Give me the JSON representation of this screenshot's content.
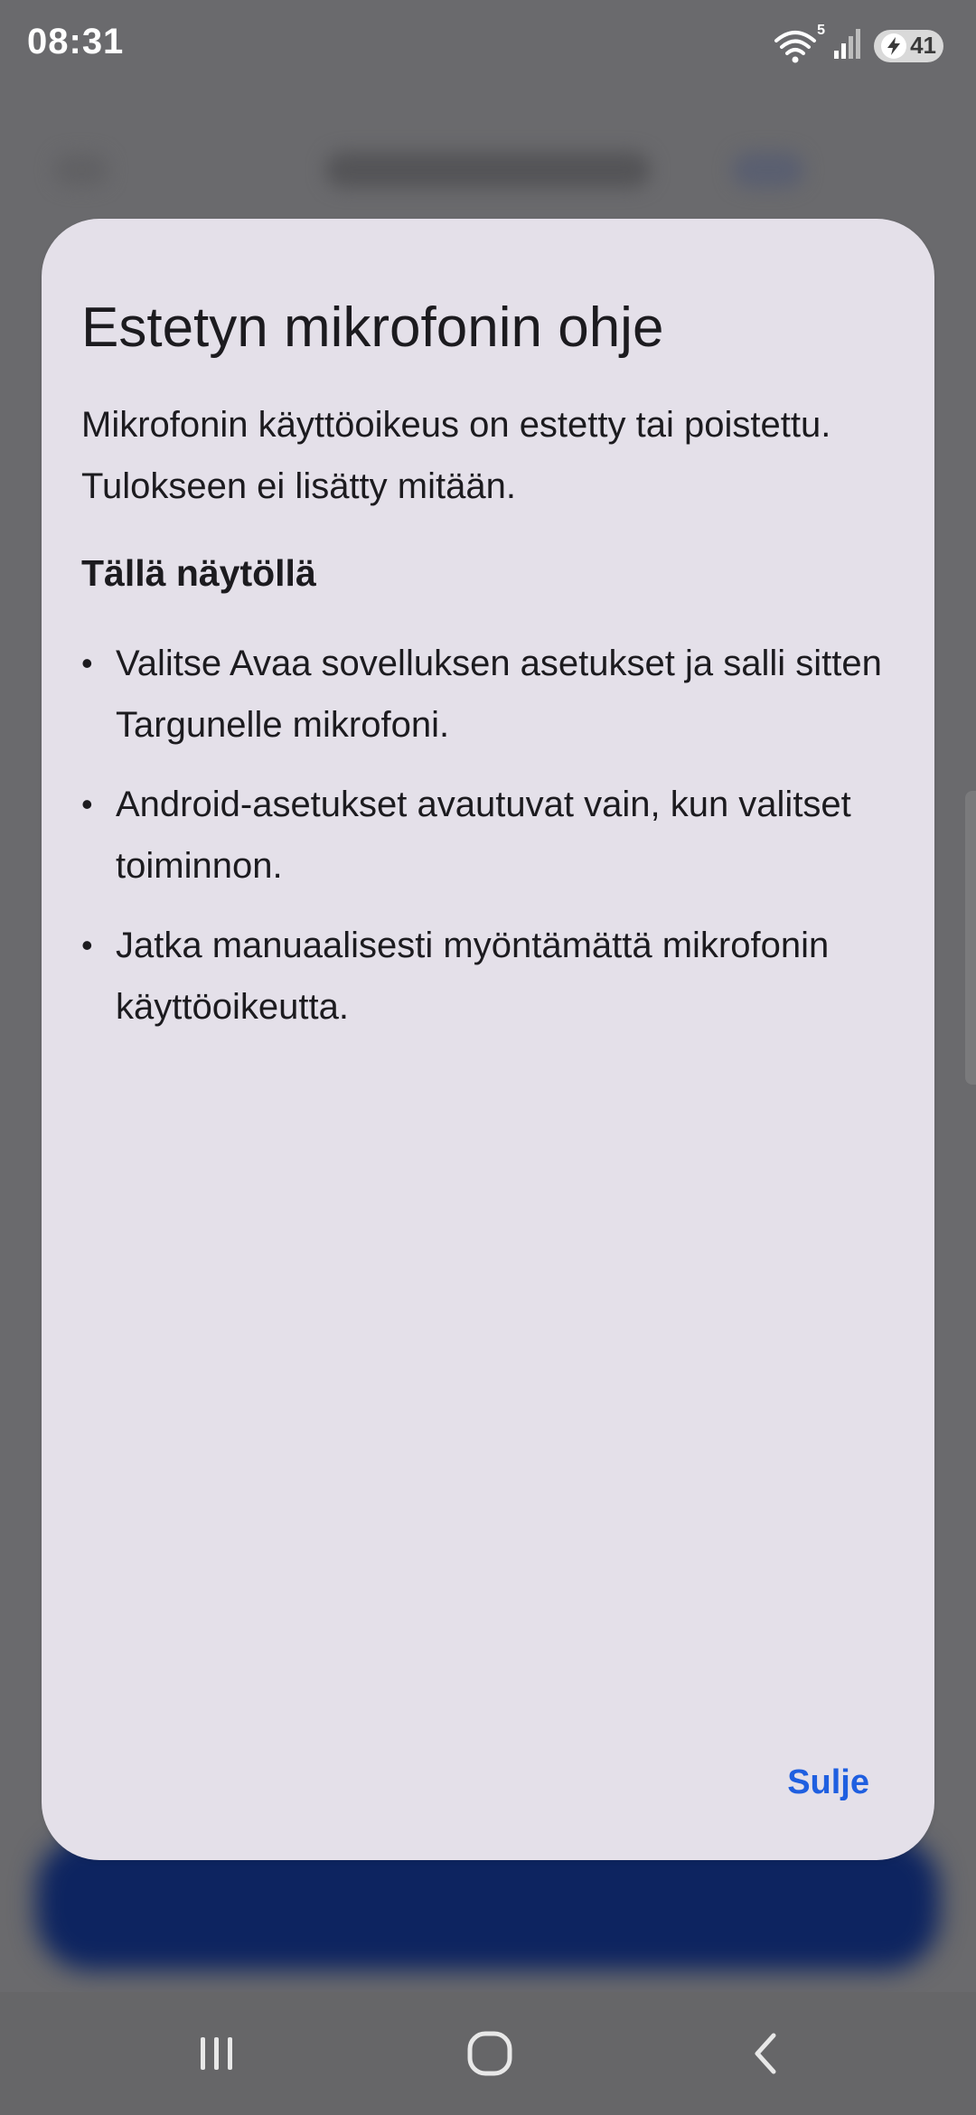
{
  "status_bar": {
    "time": "08:31",
    "wifi_badge": "5",
    "battery_level": "41"
  },
  "dialog": {
    "title": "Estetyn mikrofonin ohje",
    "message": "Mikrofonin käyttöoikeus on estetty tai poistettu. Tulokseen ei lisätty mitään.",
    "section_title": "Tällä näytöllä",
    "bullets": [
      "Valitse Avaa sovelluksen asetukset ja salli sitten Targunelle mikrofoni.",
      "Android-asetukset avautuvat vain, kun valitset toiminnon.",
      "Jatka manuaalisesti myöntämättä mikrofonin käyttöoikeutta."
    ],
    "bullet_symbol": "•",
    "close_label": "Sulje"
  },
  "colors": {
    "accent": "#1f5fe0",
    "dialog_bg": "#e4e0e9",
    "scrim": "#6a6a6d"
  },
  "icons": {
    "nav": [
      "recent-apps-icon",
      "home-icon",
      "back-icon"
    ],
    "status": [
      "wifi-icon",
      "signal-icon",
      "battery-icon"
    ]
  }
}
